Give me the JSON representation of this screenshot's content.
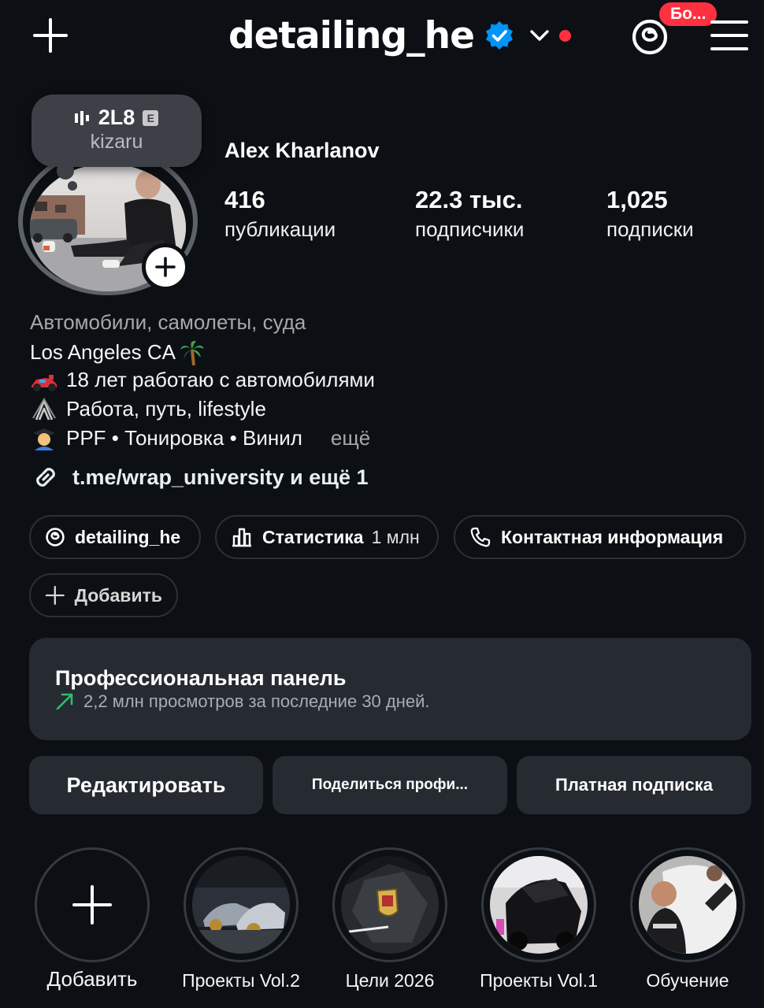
{
  "header": {
    "username": "detailing_he",
    "badge": "Бо..."
  },
  "note": {
    "song": "2L8",
    "explicit": "E",
    "artist": "kizaru"
  },
  "profile": {
    "full_name": "Alex Kharlanov",
    "stats": [
      {
        "value": "416",
        "label": "публикации"
      },
      {
        "value": "22.3 тыс.",
        "label": "подписчики"
      },
      {
        "value": "1,025",
        "label": "подписки"
      }
    ]
  },
  "bio": {
    "category": "Автомобили, самолеты, суда",
    "location": "Los Angeles CA",
    "line1": "18 лет работаю с автомобилями",
    "line2": "Работа, путь, lifestyle",
    "line3": "PPF • Тонировка • Винил",
    "more": "ещё",
    "link": "t.me/wrap_university и ещё 1"
  },
  "pills": {
    "threads": "detailing_he",
    "stats_label": "Статистика",
    "stats_value": "1 млн",
    "contact": "Контактная информация",
    "add": "Добавить"
  },
  "dashboard": {
    "title": "Профессиональная панель",
    "subtitle": "2,2 млн просмотров за последние 30 дней."
  },
  "buttons": {
    "edit": "Редактировать",
    "share": "Поделиться профи...",
    "subscription": "Платная подписка"
  },
  "highlights": [
    {
      "label": "Добавить"
    },
    {
      "label": "Проекты Vol.2"
    },
    {
      "label": "Цели 2026"
    },
    {
      "label": "Проекты Vol.1"
    },
    {
      "label": "Обучение"
    }
  ],
  "colors": {
    "background": "#0c1014",
    "verified": "#0095f6",
    "notification": "#ff3040",
    "card": "#262a31",
    "trend": "#2dbf6c"
  }
}
